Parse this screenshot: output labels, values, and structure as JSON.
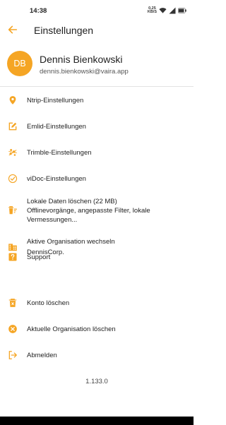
{
  "status_bar": {
    "time": "14:38",
    "net_speed_value": "0,25",
    "net_speed_unit": "KB/S",
    "icons": [
      "wifi-icon",
      "signal-icon",
      "battery-icon"
    ]
  },
  "app_bar": {
    "title": "Einstellungen",
    "back_icon": "arrow-left-icon"
  },
  "profile": {
    "initials": "DB",
    "name": "Dennis Bienkowski",
    "email": "dennis.bienkowski@vaira.app"
  },
  "menu": {
    "items": [
      {
        "icon": "location-pin-icon",
        "lines": [
          "Ntrip-Einstellungen"
        ]
      },
      {
        "icon": "edit-square-icon",
        "lines": [
          "Emlid-Einstellungen"
        ]
      },
      {
        "icon": "trimble-icon",
        "lines": [
          "Trimble-Einstellungen"
        ]
      },
      {
        "icon": "check-circle-icon",
        "lines": [
          "viDoc-Einstellungen"
        ]
      },
      {
        "icon": "delete-sweep-icon",
        "lines": [
          "Lokale Daten löschen (22 MB)",
          "Offlinevorgänge, angepasste Filter, lokale",
          "Vermessungen..."
        ]
      },
      {
        "icon": "building-icon",
        "lines": [
          "Aktive Organisation wechseln",
          "DennisCorp."
        ]
      },
      {
        "icon": "help-icon",
        "lines": [
          "Support"
        ]
      },
      {
        "icon": "trash-icon",
        "lines": [
          "Konto löschen"
        ]
      },
      {
        "icon": "cancel-circle-icon",
        "lines": [
          "Aktuelle Organisation löschen"
        ]
      },
      {
        "icon": "logout-icon",
        "lines": [
          "Abmelden"
        ]
      }
    ]
  },
  "version": "1.133.0",
  "colors": {
    "accent": "#f5a524",
    "text": "#1f1f1f",
    "divider": "#e3e3e3"
  }
}
